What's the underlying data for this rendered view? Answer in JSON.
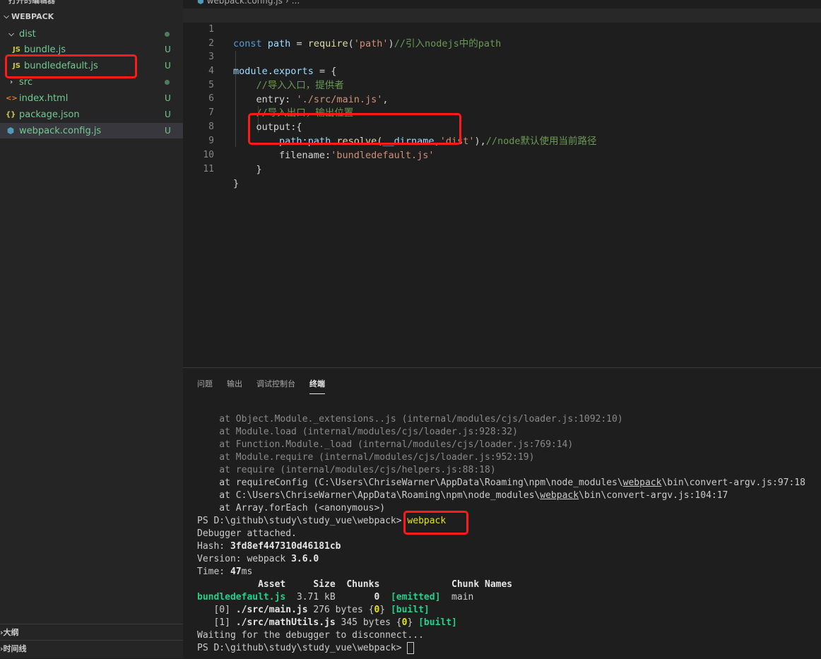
{
  "sidebar": {
    "open_editors_label": "打开的编辑器",
    "workspace_label": "WEBPACK",
    "tree": [
      {
        "label": "dist",
        "type": "folder",
        "badge": "dot"
      },
      {
        "label": "bundle.js",
        "type": "js",
        "badge": "U"
      },
      {
        "label": "bundledefault.js",
        "type": "js",
        "badge": "U"
      },
      {
        "label": "src",
        "type": "folder-collapsed",
        "badge": "dot"
      },
      {
        "label": "index.html",
        "type": "html",
        "badge": "U"
      },
      {
        "label": "package.json",
        "type": "json",
        "badge": "U"
      },
      {
        "label": "webpack.config.js",
        "type": "config",
        "badge": "U"
      }
    ],
    "outline_label": "大纲",
    "timeline_label": "时间线"
  },
  "icons": {
    "js": "JS",
    "html": "<>",
    "json": "{}",
    "config": "⬢"
  },
  "editor": {
    "breadcrumb_file": "webpack.config.js",
    "breadcrumb_more": "...",
    "line_numbers": [
      "1",
      "2",
      "3",
      "4",
      "5",
      "6",
      "7",
      "8",
      "9",
      "10",
      "11"
    ]
  },
  "panel": {
    "tabs": [
      "问题",
      "输出",
      "调试控制台",
      "终端"
    ],
    "active_tab": "终端"
  },
  "terminal": {
    "prompt": "PS D:\\github\\study\\study_vue\\webpack>",
    "command": "webpack",
    "hash_label": "Hash:",
    "hash_value": "3fd8ef447310d46181cb",
    "version_label": "Version: webpack",
    "version_value": "3.6.0",
    "time_label": "Time:",
    "time_value": "47",
    "time_unit": "ms",
    "debugger_attached": "Debugger attached.",
    "waiting": "Waiting for the debugger to disconnect..."
  },
  "highlight_color": "#ff1a1a"
}
